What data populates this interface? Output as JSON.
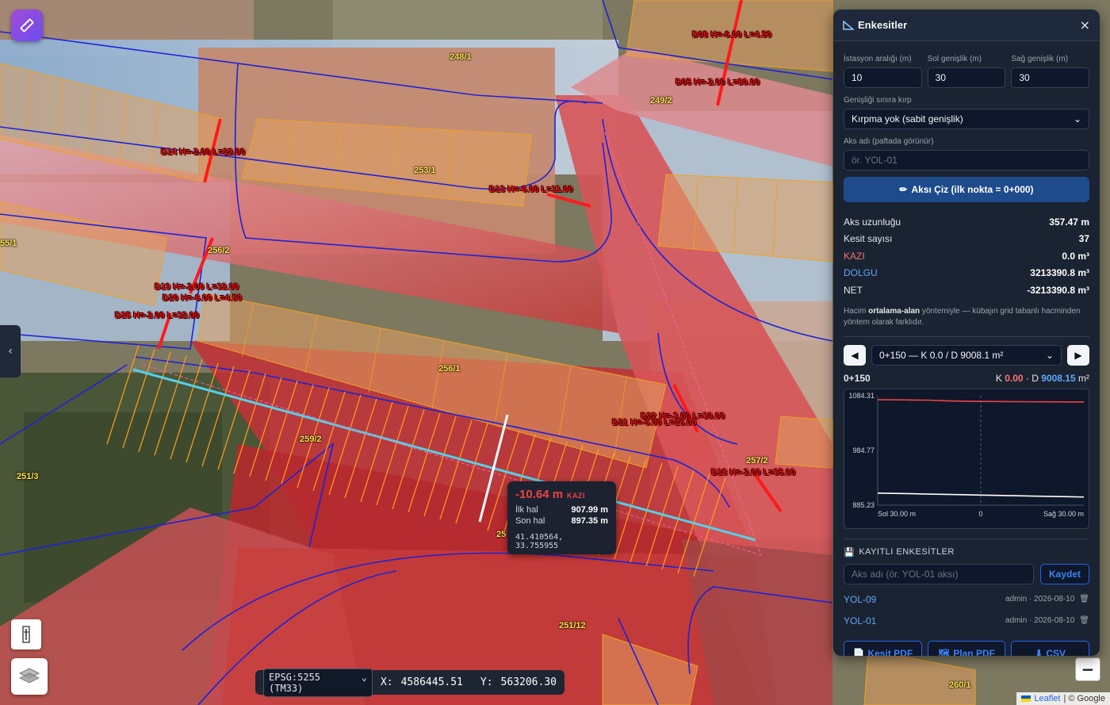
{
  "map": {
    "parcels": [
      "248/1",
      "249/2",
      "253/1",
      "256/2",
      "55/1",
      "256/1",
      "259/2",
      "251/3",
      "257/2",
      "25",
      "251/12",
      "260/1"
    ],
    "culverts": [
      "D08 H=-6.00 L=4.50",
      "D05 H=-2.00 L=80.00",
      "D14 H=-2.00 L=22.00",
      "D13 H=-6.00 L=11.00",
      "D19 H=-2.00 L=32.00",
      "D20 H=-6.00 L=4.50",
      "D25 H=-2.00 L=32.00",
      "D22 H=-3.00 L=30.00",
      "D21 H=-6.00 L=26.00",
      "D18 H=-2.00 L=35.00"
    ],
    "crs": "EPSG:5255 (TM33)",
    "x_label": "X:",
    "x_value": "4586445.51",
    "y_label": "Y:",
    "y_value": "563206.30",
    "attribution_leaflet": "Leaflet",
    "attribution_google": "| © Google"
  },
  "tooltip": {
    "depth": "-10.64 m",
    "type": "KAZI",
    "existing_label": "İlk hal",
    "existing_value": "907.99 m",
    "final_label": "Son hal",
    "final_value": "897.35 m",
    "latlon": "41.410564, 33.755955"
  },
  "panel": {
    "title": "Enkesitler",
    "station_interval_label": "İstasyon aralığı (m)",
    "station_interval": "10",
    "left_width_label": "Sol genişlik (m)",
    "left_width": "30",
    "right_width_label": "Sağ genişlik (m)",
    "right_width": "30",
    "clip_label": "Genişliği sınıra kırp",
    "clip_value": "Kırpma yok (sabit genişlik)",
    "axis_name_label": "Aks adı (paftada görünür)",
    "axis_name_placeholder": "ör. YOL-01",
    "draw_button": "Aksı Çiz (ilk nokta = 0+000)",
    "stats": [
      {
        "label": "Aks uzunluğu",
        "value": "357.47 m",
        "color": "#cbd5e1"
      },
      {
        "label": "Kesit sayısı",
        "value": "37",
        "color": "#cbd5e1"
      },
      {
        "label": "KAZI",
        "value": "0.0 m³",
        "color": "#f87171"
      },
      {
        "label": "DOLGU",
        "value": "3213390.8 m³",
        "color": "#60a5fa"
      },
      {
        "label": "NET",
        "value": "-3213390.8 m³",
        "color": "#cbd5e1"
      }
    ],
    "note_pre": "Hacim ",
    "note_bold": "ortalama-alan",
    "note_post": " yöntemiyle — kübajın grid tabanlı hacminden yöntem olarak farklıdır.",
    "station_select": "0+150 — K 0.0 / D 9008.1 m²",
    "section_station": "0+150",
    "section_k_label": "K",
    "section_k": "0.00",
    "section_d_label": "· D",
    "section_d": "9008.15",
    "section_unit": "m²",
    "saved_title": "KAYITLI ENKESİTLER",
    "save_placeholder": "Aks adı (ör. YOL-01 aksı)",
    "save_button": "Kaydet",
    "saved": [
      {
        "name": "YOL-09",
        "meta": "admin · 2026-08-10"
      },
      {
        "name": "YOL-01",
        "meta": "admin · 2026-08-10"
      }
    ],
    "export_section_pdf": "Kesit PDF",
    "export_plan_pdf": "Plan PDF",
    "export_csv": "CSV"
  },
  "chart_data": {
    "type": "line",
    "x": [
      -30,
      -25,
      -20,
      -15,
      -10,
      -5,
      0,
      5,
      10,
      15,
      20,
      25,
      30
    ],
    "xticks": [
      "Sol 30.00 m",
      "0",
      "Sağ 30.00 m"
    ],
    "yticks": [
      "1084.31",
      "984.77",
      "885.23"
    ],
    "ylim": [
      885.23,
      1084.31
    ],
    "series": [
      {
        "color": "#ef4444",
        "values": [
          1077.0,
          1076.8,
          1076.5,
          1076.2,
          1075.0,
          1074.3,
          1074.0,
          1073.8,
          1073.5,
          1073.3,
          1073.2,
          1073.0,
          1072.8
        ]
      },
      {
        "color": "#ffffff",
        "values": [
          907.2,
          906.6,
          906.0,
          905.4,
          904.8,
          904.2,
          903.6,
          903.0,
          902.4,
          901.8,
          901.2,
          900.6,
          900.0
        ]
      }
    ],
    "grid": false
  }
}
